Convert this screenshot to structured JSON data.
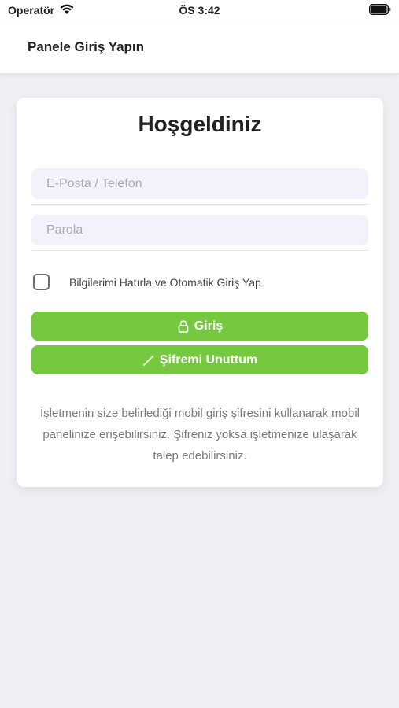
{
  "status_bar": {
    "carrier": "Operatör",
    "time": "ÖS 3:42",
    "wifi_icon": "wifi-icon",
    "battery_icon": "battery-icon"
  },
  "nav": {
    "title": "Panele Giriş Yapın"
  },
  "card": {
    "title": "Hoşgeldiniz",
    "email_placeholder": "E-Posta / Telefon",
    "password_placeholder": "Parola",
    "remember_label": "Bilgilerimi Hatırla ve Otomatik Giriş Yap",
    "remember_checked": false,
    "login_label": "Giriş",
    "login_icon": "lock-icon",
    "forgot_label": "Şifremi Unuttum",
    "forgot_icon": "magic-wand-icon",
    "info": "İşletmenin size belirlediği mobil giriş şifresini kullanarak mobil panelinize erişebilirsiniz. Şifreniz yoksa işletmenize ulaşarak talep edebilirsiniz."
  },
  "colors": {
    "accent": "#76c93f",
    "background": "#efeff4",
    "input_background": "#f3f2fb"
  }
}
